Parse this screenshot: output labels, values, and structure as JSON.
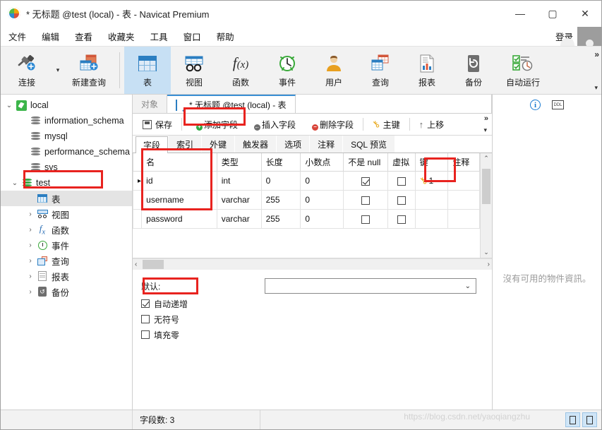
{
  "window": {
    "title": "* 无标题 @test (local) - 表 - Navicat Premium",
    "minimize": "—",
    "maximize": "▢",
    "close": "✕"
  },
  "menubar": {
    "items": [
      "文件",
      "编辑",
      "查看",
      "收藏夹",
      "工具",
      "窗口",
      "帮助"
    ],
    "login_label": "登录"
  },
  "ribbon": {
    "items": [
      {
        "label": "连接",
        "icon": "connection-icon"
      },
      {
        "label": "新建查询",
        "icon": "new-query-icon"
      },
      {
        "label": "表",
        "icon": "table-icon"
      },
      {
        "label": "视图",
        "icon": "view-icon"
      },
      {
        "label": "函数",
        "icon": "function-icon"
      },
      {
        "label": "事件",
        "icon": "event-icon"
      },
      {
        "label": "用户",
        "icon": "user-icon"
      },
      {
        "label": "查询",
        "icon": "query-icon"
      },
      {
        "label": "报表",
        "icon": "report-icon"
      },
      {
        "label": "备份",
        "icon": "backup-icon"
      },
      {
        "label": "自动运行",
        "icon": "automation-icon"
      }
    ],
    "selected": "表",
    "overflow": "»"
  },
  "sidebar": {
    "items": [
      {
        "label": "local",
        "icon": "navicat-connection-icon",
        "level": 0,
        "expander": "⌄",
        "selected": false
      },
      {
        "label": "information_schema",
        "icon": "database-icon",
        "level": 1,
        "expander": "",
        "selected": false
      },
      {
        "label": "mysql",
        "icon": "database-icon",
        "level": 1,
        "expander": "",
        "selected": false
      },
      {
        "label": "performance_schema",
        "icon": "database-icon",
        "level": 1,
        "expander": "",
        "selected": false
      },
      {
        "label": "sys",
        "icon": "database-icon",
        "level": 1,
        "expander": "",
        "selected": false
      },
      {
        "label": "test",
        "icon": "database-green-icon",
        "level": 1,
        "expander": "⌄",
        "selected": false
      },
      {
        "label": "表",
        "icon": "table-icon",
        "level": 2,
        "expander": "",
        "selected": true
      },
      {
        "label": "视图",
        "icon": "view-icon",
        "level": 2,
        "expander": "›",
        "selected": false
      },
      {
        "label": "函数",
        "icon": "function-icon",
        "level": 2,
        "expander": "›",
        "selected": false
      },
      {
        "label": "事件",
        "icon": "event-icon",
        "level": 2,
        "expander": "›",
        "selected": false
      },
      {
        "label": "查询",
        "icon": "query-icon",
        "level": 2,
        "expander": "›",
        "selected": false
      },
      {
        "label": "报表",
        "icon": "report-icon",
        "level": 2,
        "expander": "›",
        "selected": false
      },
      {
        "label": "备份",
        "icon": "backup-icon",
        "level": 2,
        "expander": "›",
        "selected": false
      }
    ]
  },
  "doc_tabs": {
    "object_tab": "对象",
    "active_tab": "* 无标题 @test (local) - 表"
  },
  "subtoolbar": {
    "save": "保存",
    "add_field": "添加字段",
    "insert_field": "插入字段",
    "delete_field": "删除字段",
    "primary_key": "主键",
    "move_up": "上移",
    "overflow": "»"
  },
  "field_tabs": {
    "items": [
      "字段",
      "索引",
      "外键",
      "触发器",
      "选项",
      "注释",
      "SQL 预览"
    ],
    "active": "字段"
  },
  "grid": {
    "columns": [
      "名",
      "类型",
      "长度",
      "小数点",
      "不是 null",
      "虚拟",
      "键",
      "注释"
    ],
    "rows": [
      {
        "selector": "▸",
        "name": "id",
        "type": "int",
        "length": "0",
        "decimals": "0",
        "not_null": true,
        "virtual": false,
        "key": "1",
        "key_icon": "key-icon",
        "comment": ""
      },
      {
        "selector": "",
        "name": "username",
        "type": "varchar",
        "length": "255",
        "decimals": "0",
        "not_null": false,
        "virtual": false,
        "key": "",
        "key_icon": "",
        "comment": ""
      },
      {
        "selector": "",
        "name": "password",
        "type": "varchar",
        "length": "255",
        "decimals": "0",
        "not_null": false,
        "virtual": false,
        "key": "",
        "key_icon": "",
        "comment": ""
      }
    ]
  },
  "properties": {
    "default_label": "默认:",
    "default_value": "",
    "checkboxes": [
      {
        "label": "自动递增",
        "checked": true
      },
      {
        "label": "无符号",
        "checked": false
      },
      {
        "label": "填充零",
        "checked": false
      }
    ]
  },
  "right_panel": {
    "info_icon": "info-icon",
    "ddl_icon": "ddl-icon",
    "ddl_text": "DDL",
    "empty_message": "沒有可用的物件資訊。"
  },
  "statusbar": {
    "field_count": "字段数: 3",
    "watermark": "https://blog.csdn.net/yaoqiangzhu"
  },
  "annotations": {
    "accent_color": "#e8231f",
    "boxes": [
      "sidebar-table-node",
      "add-field-button",
      "name-column",
      "key-column",
      "auto-increment-checkbox"
    ]
  }
}
